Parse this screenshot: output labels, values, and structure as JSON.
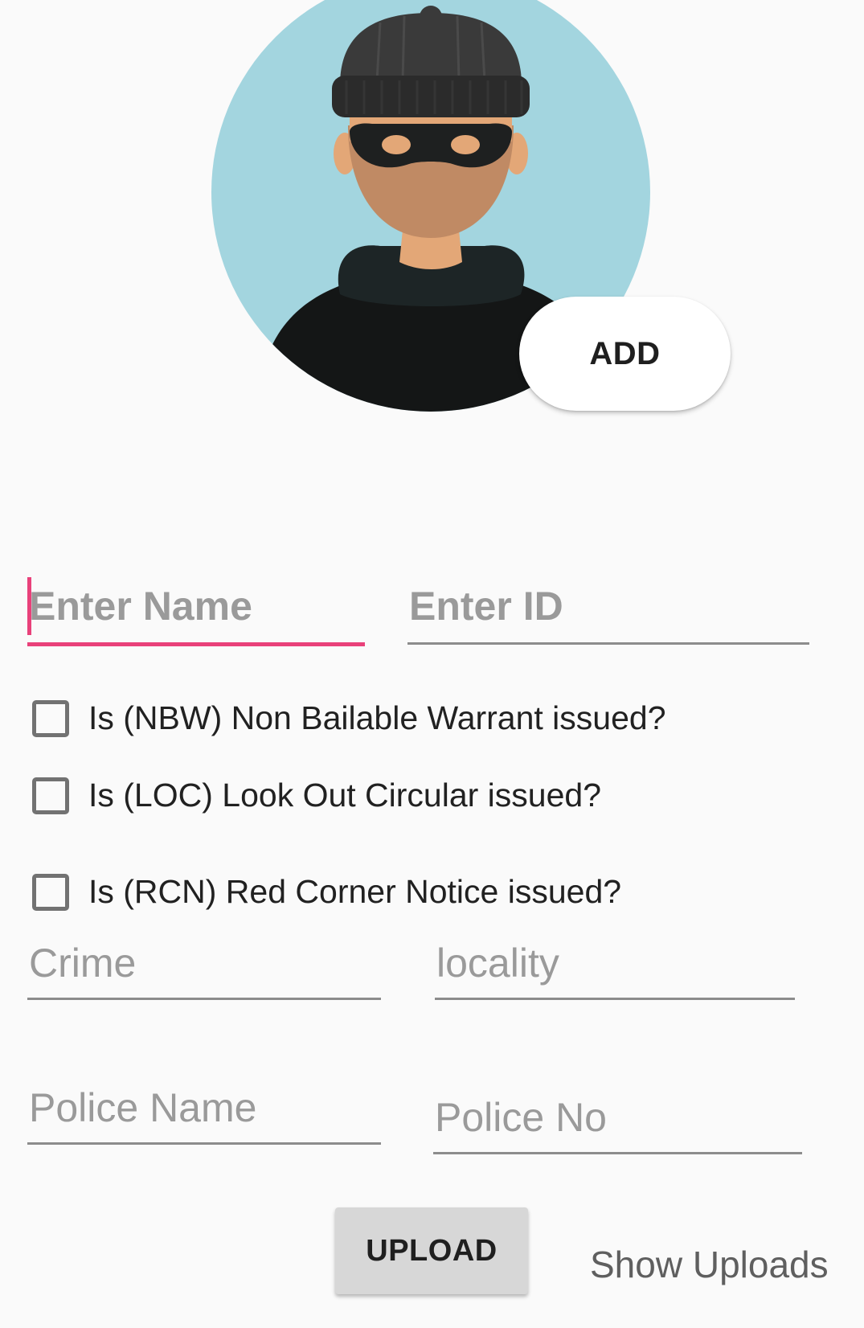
{
  "avatar": {
    "icon": "masked-thief-avatar",
    "background_color": "#a3d5df"
  },
  "add_button": {
    "label": "ADD"
  },
  "form": {
    "name_field": {
      "placeholder": "Enter Name",
      "value": ""
    },
    "id_field": {
      "placeholder": "Enter ID",
      "value": ""
    },
    "checkboxes": [
      {
        "label": "Is (NBW) Non Bailable Warrant issued?",
        "checked": false
      },
      {
        "label": "Is (LOC) Look Out Circular issued?",
        "checked": false
      },
      {
        "label": "Is (RCN) Red Corner Notice issued?",
        "checked": false
      }
    ],
    "crime_field": {
      "placeholder": "Crime",
      "value": ""
    },
    "locality_field": {
      "placeholder": "locality",
      "value": ""
    },
    "police_name_field": {
      "placeholder": "Police Name",
      "value": ""
    },
    "police_no_field": {
      "placeholder": "Police No",
      "value": ""
    }
  },
  "actions": {
    "upload_label": "UPLOAD",
    "show_uploads_label": "Show Uploads"
  },
  "colors": {
    "accent": "#e9417a",
    "background": "#fafafa",
    "button_gray": "#d7d7d7"
  }
}
